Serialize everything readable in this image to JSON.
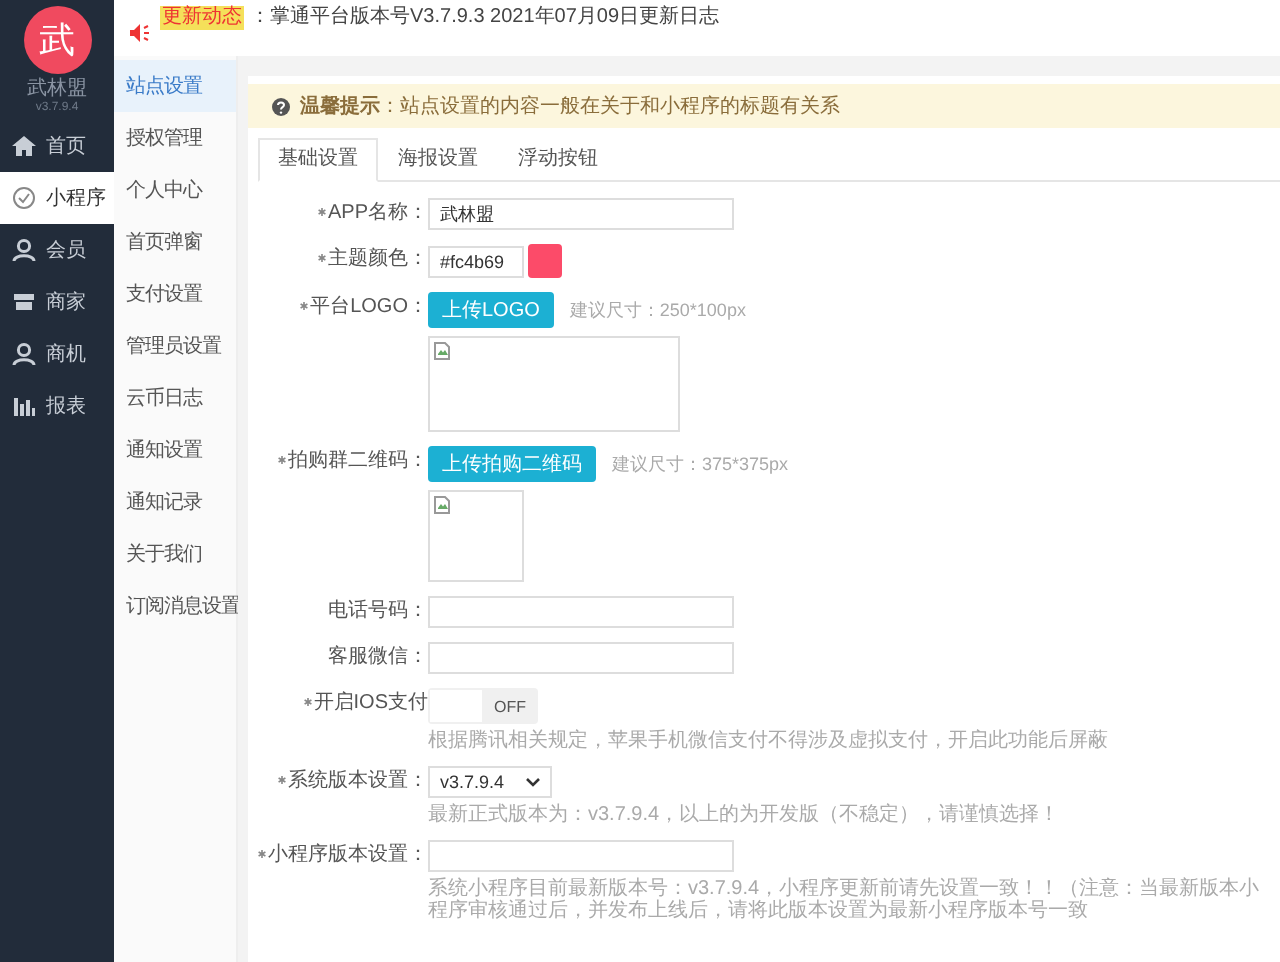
{
  "sidebar": {
    "logo": "武",
    "name": "武林盟",
    "version": "v3.7.9.4",
    "items": [
      {
        "label": "首页",
        "selected": false
      },
      {
        "label": "小程序",
        "selected": true
      },
      {
        "label": "会员",
        "selected": false
      },
      {
        "label": "商家",
        "selected": false
      },
      {
        "label": "商机",
        "selected": false
      },
      {
        "label": "报表",
        "selected": false
      }
    ]
  },
  "notice": {
    "tag": "更新动态",
    "text": "：掌通平台版本号V3.7.9.3 2021年07月09日更新日志"
  },
  "submenu": [
    {
      "label": "站点设置",
      "selected": true
    },
    {
      "label": "授权管理",
      "selected": false
    },
    {
      "label": "个人中心",
      "selected": false
    },
    {
      "label": "首页弹窗",
      "selected": false
    },
    {
      "label": "支付设置",
      "selected": false
    },
    {
      "label": "管理员设置",
      "selected": false
    },
    {
      "label": "云币日志",
      "selected": false
    },
    {
      "label": "通知设置",
      "selected": false
    },
    {
      "label": "通知记录",
      "selected": false
    },
    {
      "label": "关于我们",
      "selected": false
    },
    {
      "label": "订阅消息设置",
      "selected": false
    }
  ],
  "alert": {
    "text": "**温馨提示**：站点设置的内容一般在关于和小程序的标题有关系"
  },
  "tabs": [
    {
      "label": "基础设置",
      "selected": true
    },
    {
      "label": "海报设置",
      "selected": false
    },
    {
      "label": "浮动按钮",
      "selected": false
    }
  ],
  "form": [
    {
      "kind": "input",
      "label": "APP名称：",
      "required": true,
      "value": "武林盟"
    },
    {
      "kind": "color",
      "label": "主题颜色：",
      "required": true,
      "value": "#fc4b69",
      "color": "#fc4b69"
    },
    {
      "kind": "upload-wide",
      "label": "平台LOGO：",
      "required": true,
      "button": "上传LOGO",
      "hint": "建议尺寸：250*100px"
    },
    {
      "kind": "upload-square",
      "label": "拍购群二维码：",
      "required": true,
      "button": "上传拍购二维码",
      "hint": "建议尺寸：375*375px"
    },
    {
      "kind": "input",
      "label": "电话号码：",
      "required": false
    },
    {
      "kind": "input",
      "label": "客服微信：",
      "required": false
    },
    {
      "kind": "toggle",
      "label": "开启IOS支付",
      "required": true,
      "on": false,
      "state": "OFF",
      "note": "根据腾讯相关规定，苹果手机微信支付不得涉及虚拟支付，开启此功能后屏蔽"
    },
    {
      "kind": "select",
      "label": "系统版本设置：",
      "required": true,
      "value": "v3.7.9.4",
      "note": "最新正式版本为：v3.7.9.4，以上的为开发版（不稳定），请谨慎选择！"
    },
    {
      "kind": "input",
      "label": "小程序版本设置：",
      "required": true,
      "note": "系统小程序目前最新版本号：v3.7.9.4，小程序更新前请先设置一致！！（注意：当最新版本小程序审核通过后，并发布上线后，请将此版本设置为最新小程序版本号一致"
    }
  ]
}
